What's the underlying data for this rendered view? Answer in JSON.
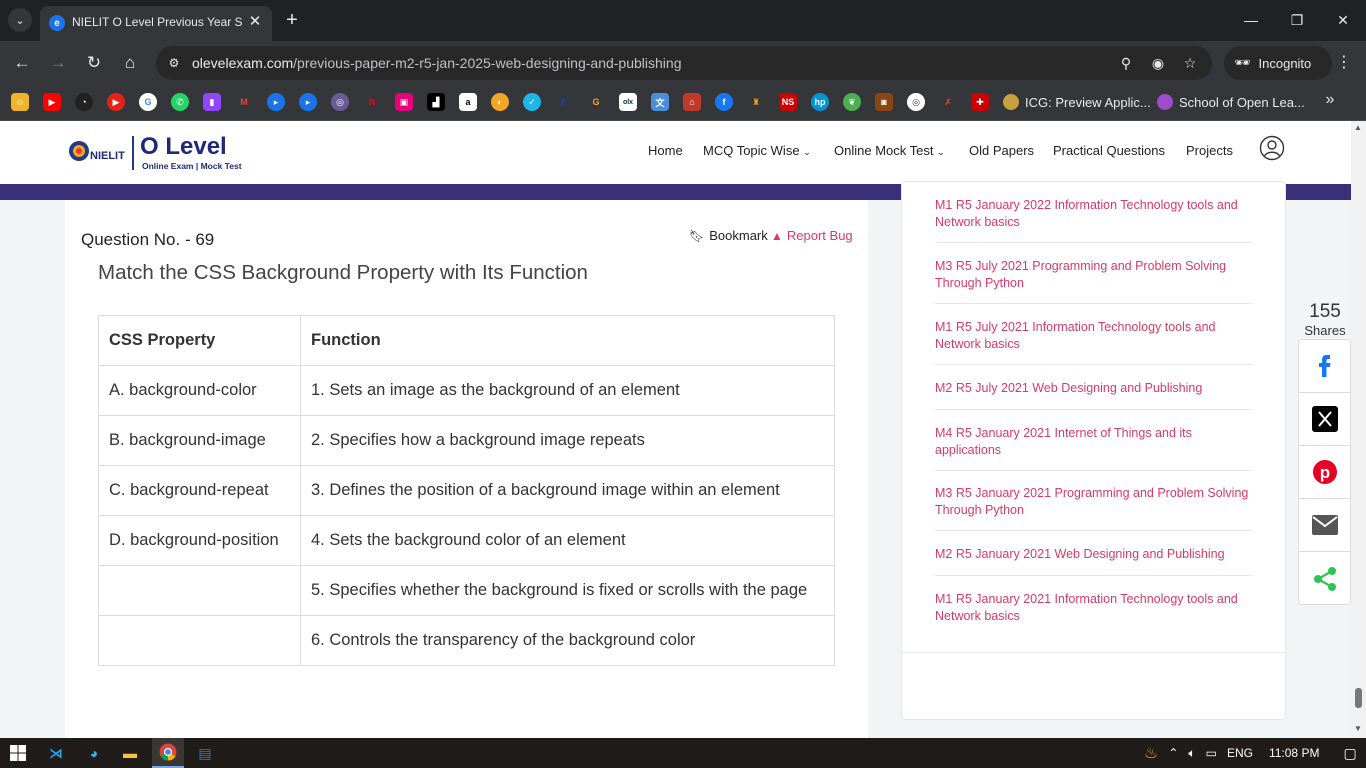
{
  "browser": {
    "tab_title": "NIELIT O Level Previous Year So",
    "url_host": "olevelexam.com",
    "url_path": "/previous-paper-m2-r5-jan-2025-web-designing-and-publishing",
    "incognito_label": "Incognito",
    "bookmarks": [
      {
        "label": "ICG: Preview Applic..."
      },
      {
        "label": "School of Open Lea..."
      }
    ]
  },
  "site": {
    "logo_title": "O Level",
    "logo_subtitle": "Online Exam | Mock Test",
    "logo_badge": "NIELIT",
    "nav": [
      {
        "label": "Home"
      },
      {
        "label": "MCQ Topic Wise"
      },
      {
        "label": "Online Mock Test"
      },
      {
        "label": "Old Papers"
      },
      {
        "label": "Practical Questions"
      },
      {
        "label": "Projects"
      }
    ]
  },
  "question": {
    "number_label": "Question No. - 69",
    "bookmark_label": "Bookmark",
    "report_label": "Report Bug",
    "title": "Match the CSS Background Property with Its Function",
    "headers": [
      "CSS Property",
      "Function"
    ],
    "rows": [
      [
        "A. background-color",
        "1. Sets an image as the background of an element"
      ],
      [
        "B. background-image",
        "2. Specifies how a background image repeats"
      ],
      [
        "C. background-repeat",
        "3. Defines the position of a background image within an element"
      ],
      [
        "D. background-position",
        "4. Sets the background color of an element"
      ],
      [
        "",
        "5. Specifies whether the background is fixed or scrolls with the page"
      ],
      [
        "",
        "6. Controls the transparency of the background color"
      ]
    ]
  },
  "sidebar": {
    "links": [
      "M1 R5 January 2022 Information Technology tools and Network basics",
      "M3 R5 July 2021 Programming and Problem Solving Through Python",
      "M1 R5 July 2021 Information Technology tools and Network basics",
      "M2 R5 July 2021 Web Designing and Publishing",
      "M4 R5 January 2021 Internet of Things and its applications",
      "M3 R5 January 2021 Programming and Problem Solving Through Python",
      "M2 R5 January 2021 Web Designing and Publishing",
      "M1 R5 January 2021 Information Technology tools and Network basics"
    ]
  },
  "share": {
    "count": "155",
    "label": "Shares"
  },
  "taskbar": {
    "language": "ENG",
    "time": "11:08 PM"
  },
  "colors": {
    "accent_pink": "#d63a6a",
    "brand_navy": "#1e2a78",
    "purple_bar": "#3b2f7a",
    "facebook": "#1877f2",
    "pinterest": "#e60023",
    "share_green": "#2ec451"
  }
}
